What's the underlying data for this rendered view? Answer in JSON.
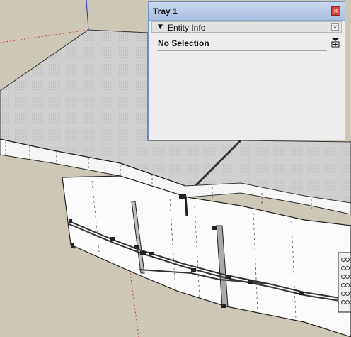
{
  "tray": {
    "title": "Tray 1",
    "close_glyph": "×"
  },
  "entity_info_panel": {
    "collapse_glyph": "▼",
    "title": "Entity Info",
    "close_glyph": "×",
    "selection_label": "No Selection",
    "detail_toggle_icon": "expand-details-icon"
  },
  "viewport": {
    "scene": "3d-model-curved-counter",
    "sky_ground_color": "#ccc7b6",
    "top_surface_color": "#cfcfcf",
    "face_color": "#fbfbfb",
    "axis_colors": {
      "blue": "#2a2ad0",
      "green": "#2fae2f",
      "red": "#c33"
    }
  }
}
